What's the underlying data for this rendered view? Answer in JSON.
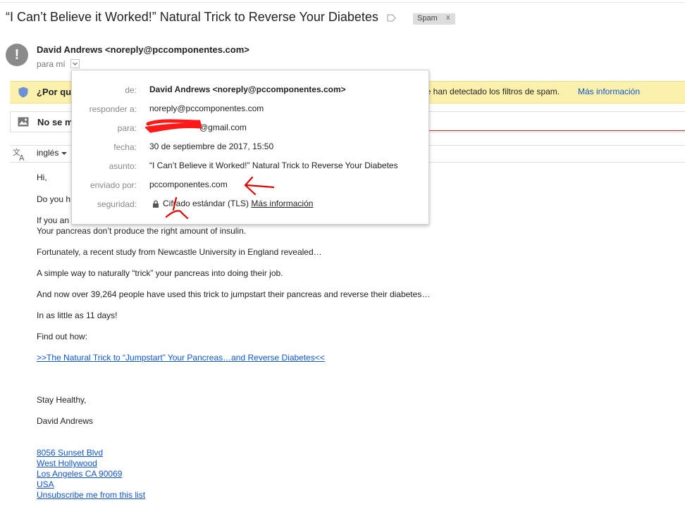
{
  "email": {
    "subject": "“I Can’t Believe it Worked!” Natural Trick to Reverse Your Diabetes",
    "label_chip": "Spam",
    "label_close": "x",
    "avatar_glyph": "!",
    "sender_line": "David Andrews <noreply@pccomponentes.com>",
    "to_me": "para mí"
  },
  "warning": {
    "start": "¿Por qu",
    "end": "he han detectado los filtros de spam.",
    "link": "Más información"
  },
  "images_bar": {
    "text": "No se m"
  },
  "translate": {
    "language": "inglés"
  },
  "details": {
    "rows": [
      {
        "label": "de:",
        "value": "David Andrews <noreply@pccomponentes.com>"
      },
      {
        "label": "responder a:",
        "value": "noreply@pccomponentes.com"
      },
      {
        "label": "para:",
        "value": "@gmail.com"
      },
      {
        "label": "fecha:",
        "value": "30 de septiembre de 2017, 15:50"
      },
      {
        "label": "asunto:",
        "value": "“I Can’t Believe it Worked!” Natural Trick to Reverse Your Diabetes"
      },
      {
        "label": "enviado por:",
        "value": "pccomponentes.com"
      },
      {
        "label": "seguridad:",
        "value": "Cifrado estándar (TLS)"
      }
    ],
    "security_link": "Más información"
  },
  "body": {
    "greeting": "Hi,",
    "line_do": "Do you h",
    "line_if": "If you an",
    "line_pancreas": "Your pancreas don’t produce the right amount of insulin.",
    "line_fortunately": "Fortunately, a recent study from Newcastle University in England revealed…",
    "line_simple": "A simple way to naturally “trick” your pancreas into doing their job.",
    "line_now": "And now over 39,264 people have used this trick to jumpstart their pancreas and reverse their diabetes…",
    "line_little": "In as little as 11 days!",
    "line_find": "Find out how:",
    "cta_link": ">>The Natural Trick to “Jumpstart” Your Pancreas…and Reverse Diabetes<<",
    "sign_off": "Stay Healthy,",
    "signature": "David Andrews",
    "address_1": "8056 Sunset Blvd",
    "address_2": "West Hollywood",
    "address_3": "Los Angeles CA 90069",
    "address_4": "USA",
    "unsubscribe": "Unsubscribe me from this list"
  },
  "colors": {
    "link": "#1155cc",
    "warning_bg": "#fcf0ad",
    "annotation": "#e00000"
  }
}
